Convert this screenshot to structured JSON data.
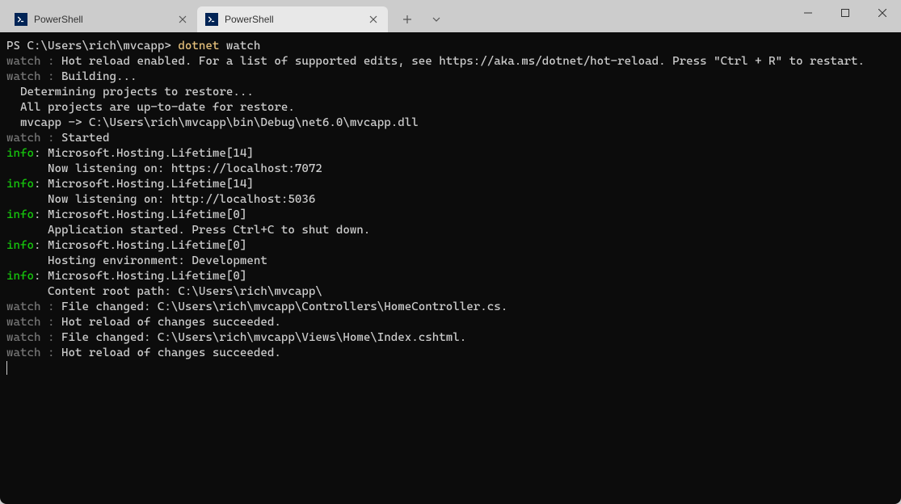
{
  "tabs": [
    {
      "label": "PowerShell"
    },
    {
      "label": "PowerShell"
    }
  ],
  "terminal": {
    "prompt": "PS C:\\Users\\rich\\mvcapp> ",
    "cmd_primary": "dotnet ",
    "cmd_secondary": "watch",
    "lines": {
      "w1": "watch ",
      "colon": ": ",
      "hot_reload_enabled": "Hot reload enabled. For a list of supported edits, see https://aka.ms/dotnet/hot-reload. Press \"Ctrl + R\" to restart.",
      "building": "Building...",
      "determining": "  Determining projects to restore...",
      "uptodate": "  All projects are up-to-date for restore.",
      "build_output": "  mvcapp -> C:\\Users\\rich\\mvcapp\\bin\\Debug\\net6.0\\mvcapp.dll",
      "started": "Started",
      "info_label": "info",
      "lifetime14": ": Microsoft.Hosting.Lifetime[14]",
      "listen_https": "      Now listening on: https://localhost:7072",
      "listen_http": "      Now listening on: http://localhost:5036",
      "lifetime0": ": Microsoft.Hosting.Lifetime[0]",
      "app_started": "      Application started. Press Ctrl+C to shut down.",
      "hosting_env": "      Hosting environment: Development",
      "content_root": "      Content root path: C:\\Users\\rich\\mvcapp\\",
      "file_changed1": "File changed: C:\\Users\\rich\\mvcapp\\Controllers\\HomeController.cs.",
      "hot_reload_ok": "Hot reload of changes succeeded.",
      "file_changed2": "File changed: C:\\Users\\rich\\mvcapp\\Views\\Home\\Index.cshtml."
    }
  }
}
